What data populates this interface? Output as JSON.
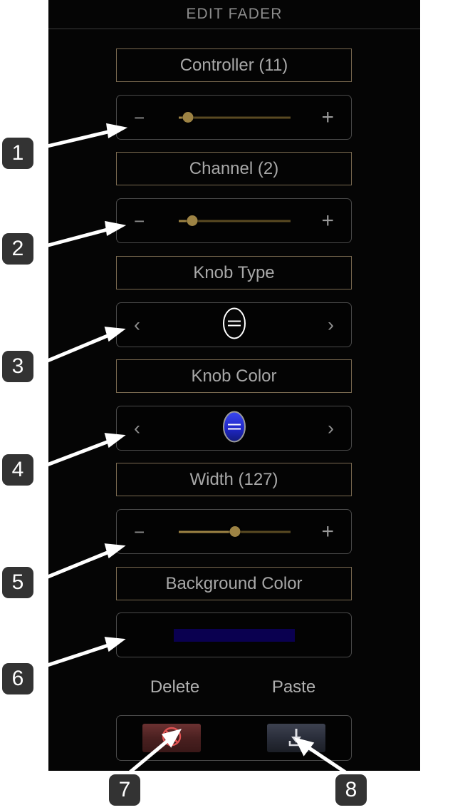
{
  "window": {
    "title": "EDIT FADER",
    "background": "#050505",
    "accent_border": "#7a6a50",
    "control_border": "#4a4a4a"
  },
  "controls": [
    {
      "id": "controller",
      "label": "Controller (11)",
      "type": "slider",
      "minus_label": "−",
      "plus_label": "+",
      "value_pct": 8,
      "track_color": "#5a4a22",
      "knob_color": "#9d8344"
    },
    {
      "id": "channel",
      "label": "Channel (2)",
      "type": "slider",
      "minus_label": "−",
      "plus_label": "+",
      "value_pct": 12,
      "track_color": "#5a4a22",
      "knob_color": "#9d8344"
    },
    {
      "id": "knob-type",
      "label": "Knob Type",
      "type": "selector",
      "prev_label": "‹",
      "next_label": "›",
      "preview": "outline-ellipse-knob"
    },
    {
      "id": "knob-color",
      "label": "Knob Color",
      "type": "selector",
      "prev_label": "‹",
      "next_label": "›",
      "preview": "blue-ellipse-knob",
      "color": "#2430d8"
    },
    {
      "id": "width",
      "label": "Width (127)",
      "type": "slider",
      "minus_label": "−",
      "plus_label": "+",
      "value_pct": 50,
      "track_color": "#5a4a22",
      "knob_color": "#9d8344"
    },
    {
      "id": "background-color",
      "label": "Background Color",
      "type": "color-swatch",
      "color": "#0a0050"
    }
  ],
  "actions": {
    "delete_label": "Delete",
    "paste_label": "Paste",
    "delete_icon": "circle-x-icon",
    "paste_icon": "download-icon",
    "delete_color": "#e05353",
    "paste_color": "#dcdde2"
  },
  "annotations": [
    {
      "number": "1"
    },
    {
      "number": "2"
    },
    {
      "number": "3"
    },
    {
      "number": "4"
    },
    {
      "number": "5"
    },
    {
      "number": "6"
    },
    {
      "number": "7"
    },
    {
      "number": "8"
    }
  ]
}
